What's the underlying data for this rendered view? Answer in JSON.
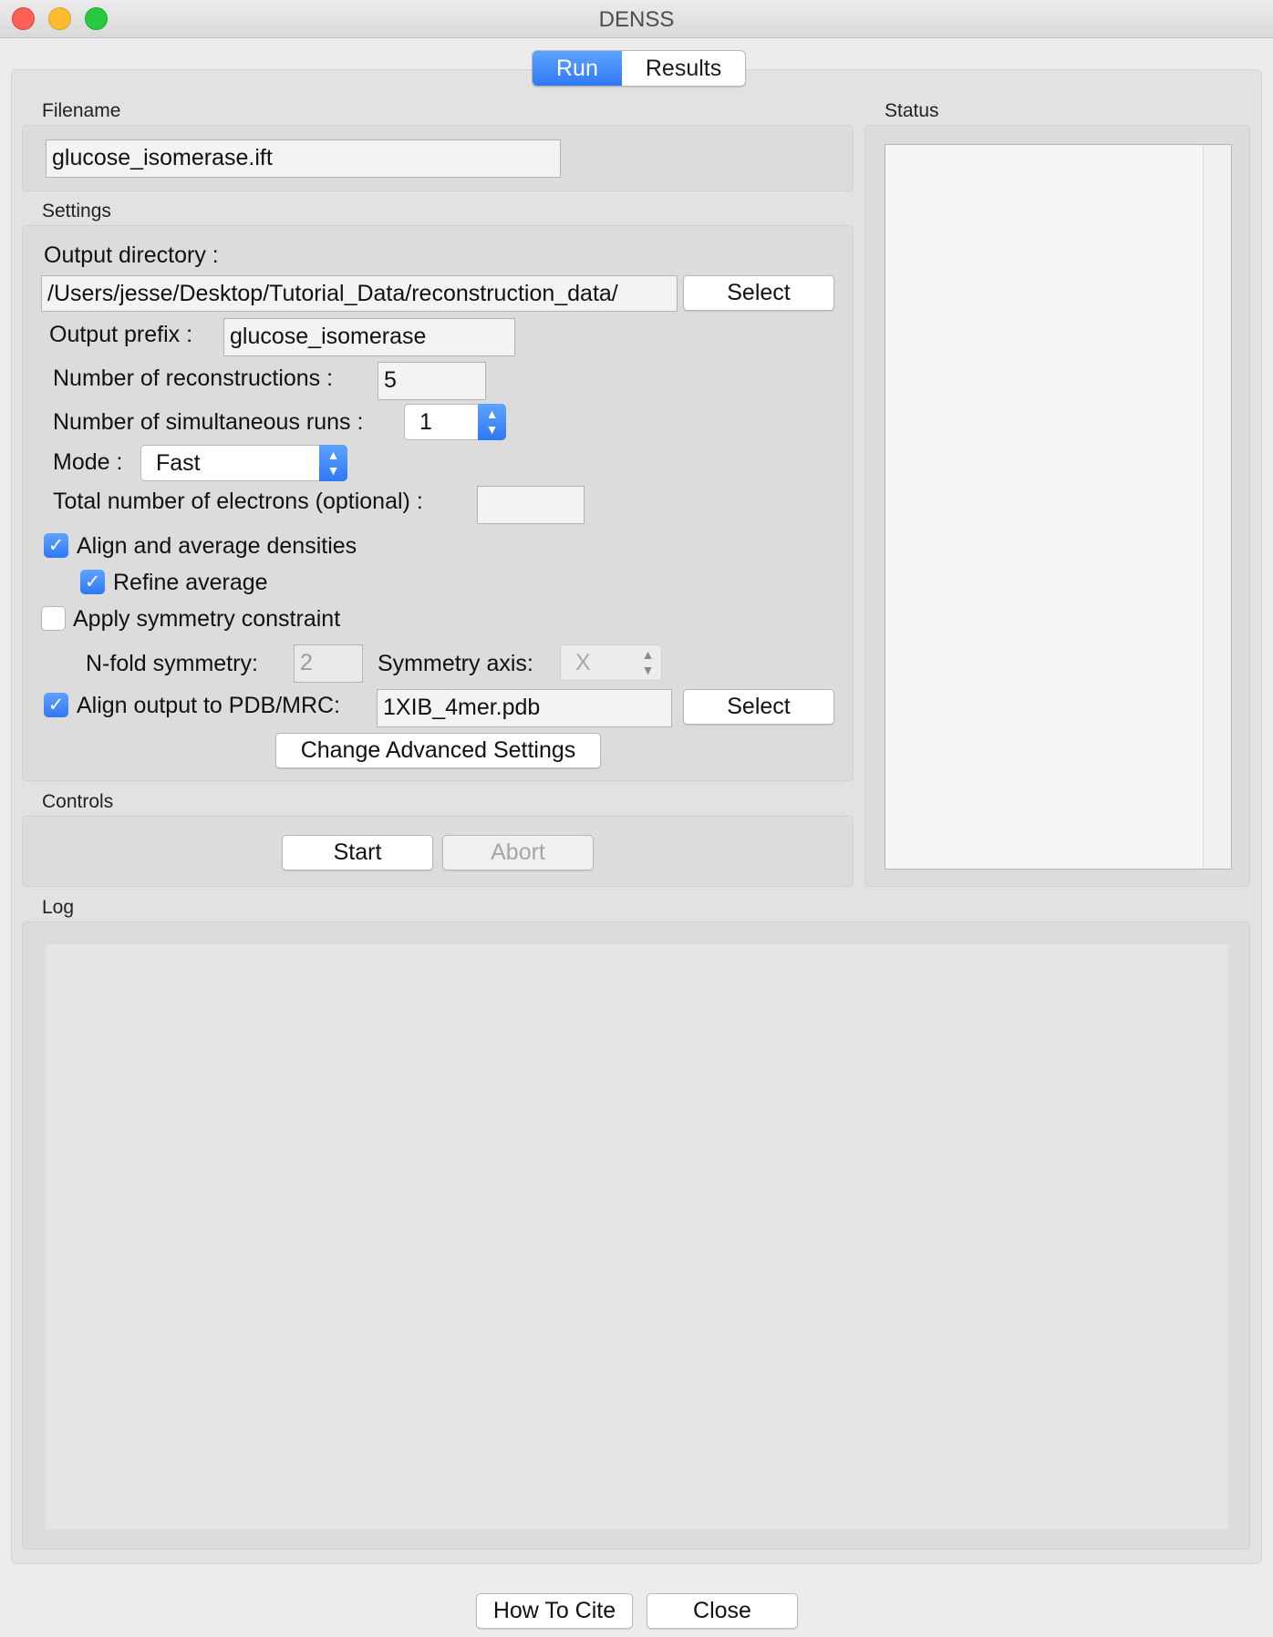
{
  "window": {
    "title": "DENSS"
  },
  "tabs": [
    {
      "label": "Run"
    },
    {
      "label": "Results"
    }
  ],
  "groups": {
    "filename": "Filename",
    "settings": "Settings",
    "controls": "Controls",
    "status": "Status",
    "log": "Log"
  },
  "filename": {
    "value": "glucose_isomerase.ift"
  },
  "settings": {
    "output_dir_label": "Output directory :",
    "output_dir_value": "/Users/jesse/Desktop/Tutorial_Data/reconstruction_data/",
    "select_label": "Select",
    "output_prefix_label": "Output prefix :",
    "output_prefix_value": "glucose_isomerase",
    "num_recon_label": "Number of reconstructions :",
    "num_recon_value": "5",
    "num_sim_label": "Number of simultaneous runs :",
    "num_sim_value": "1",
    "mode_label": "Mode :",
    "mode_value": "Fast",
    "electrons_label": "Total number of electrons (optional) :",
    "electrons_value": "",
    "align_avg_label": "Align and average densities",
    "align_avg_checked": true,
    "refine_label": "Refine average",
    "refine_checked": true,
    "symmetry_label": "Apply symmetry constraint",
    "symmetry_checked": false,
    "nfold_label": "N-fold symmetry:",
    "nfold_value": "2",
    "sym_axis_label": "Symmetry axis:",
    "sym_axis_value": "X",
    "align_pdb_label": "Align output to PDB/MRC:",
    "align_pdb_checked": true,
    "align_pdb_value": "1XIB_4mer.pdb",
    "advanced_label": "Change Advanced Settings"
  },
  "controls": {
    "start_label": "Start",
    "abort_label": "Abort"
  },
  "footer": {
    "cite_label": "How To Cite",
    "close_label": "Close"
  },
  "colors": {
    "accent": "#3b82f6",
    "background": "#ececec"
  }
}
